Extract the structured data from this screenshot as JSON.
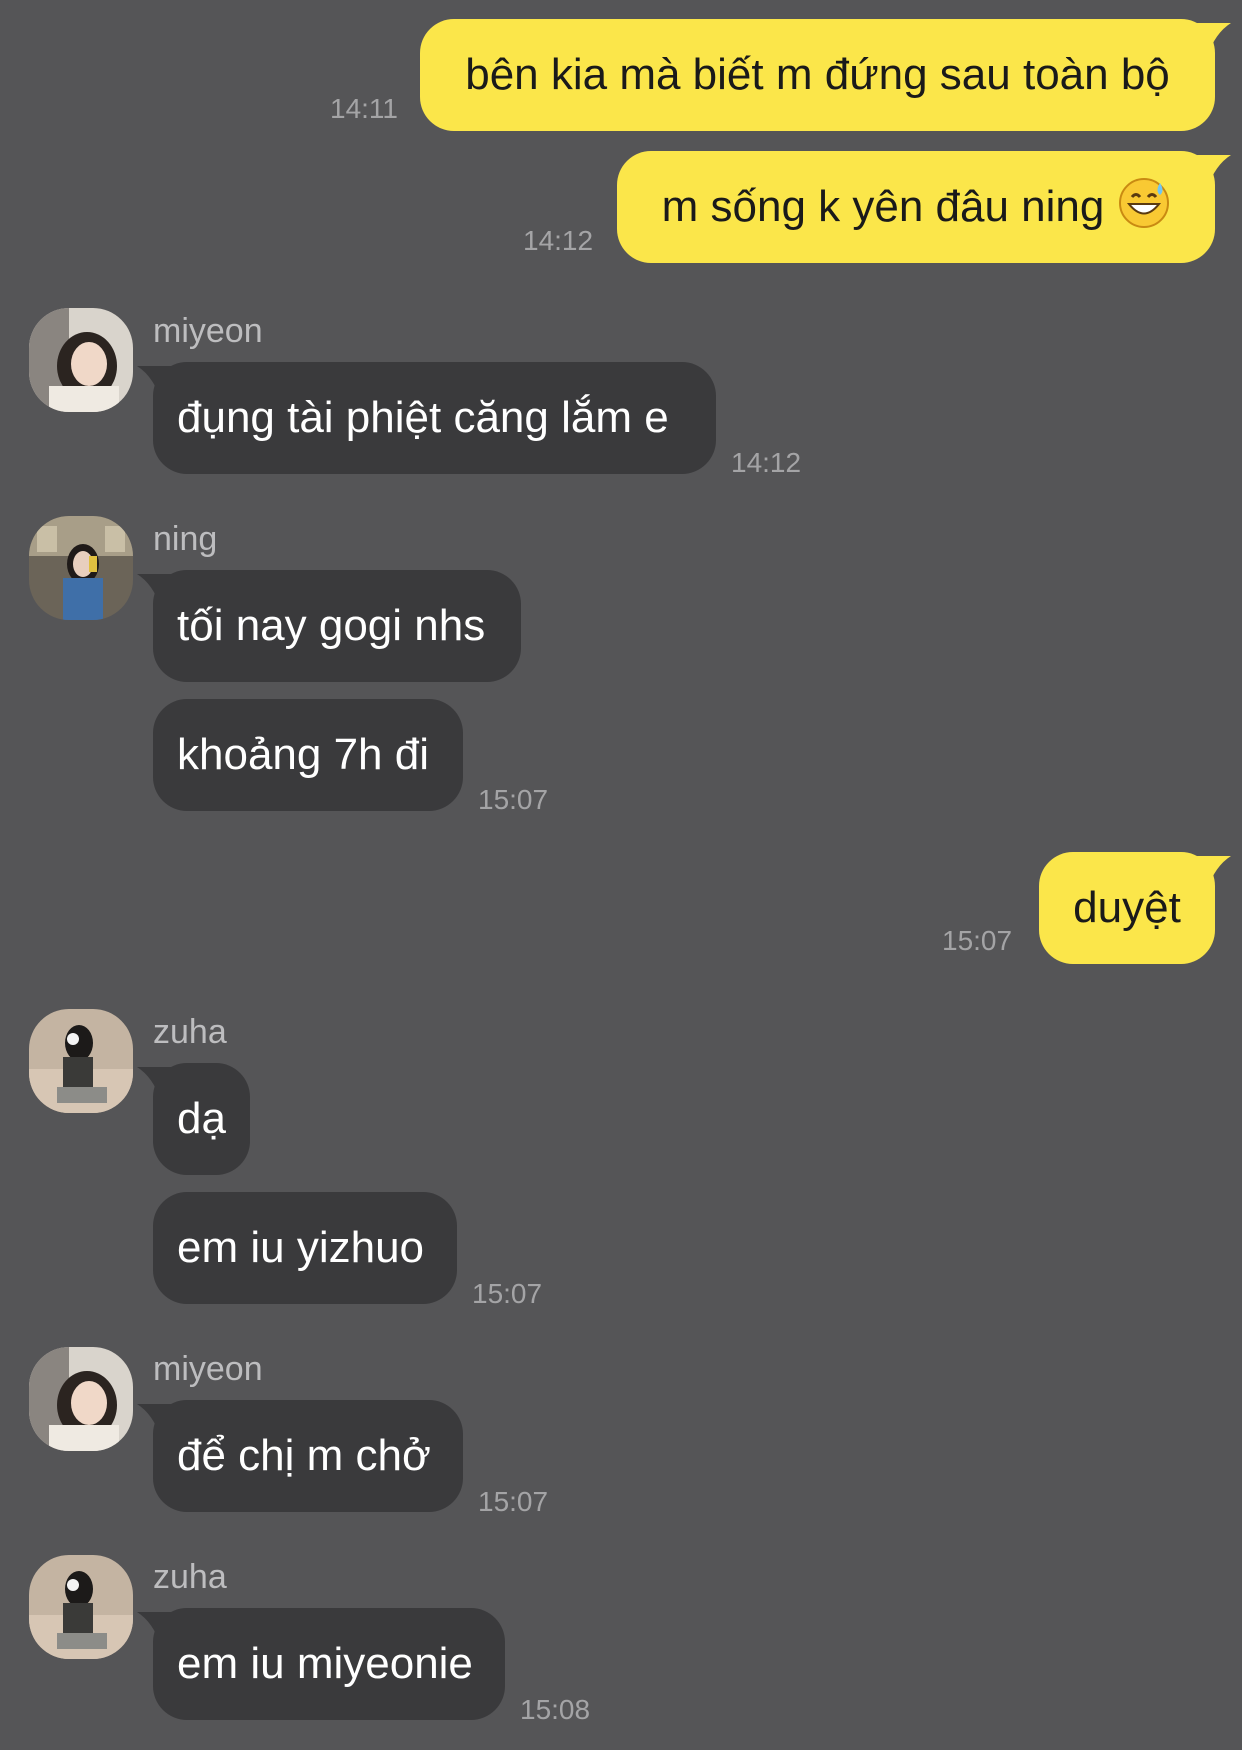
{
  "theme": {
    "background": "#555557",
    "outgoing_bubble": "#FBE64A",
    "incoming_bubble": "#3A3A3C",
    "timestamp_color": "#A4A4A6",
    "sender_color": "#BDBDBF"
  },
  "messages": [
    {
      "side": "out",
      "text": "bên kia mà biết m đứng sau toàn bộ",
      "time": "14:11"
    },
    {
      "side": "out",
      "text": "m sống k yên đâu ning",
      "emoji": "grinning-face-with-sweat",
      "time": "14:12"
    },
    {
      "side": "in",
      "sender": "miyeon",
      "text": "đụng tài phiệt căng lắm e",
      "time": "14:12"
    },
    {
      "side": "in",
      "sender": "ning",
      "text": "tối nay gogi nhs"
    },
    {
      "side": "in",
      "text": "khoảng 7h đi",
      "time": "15:07"
    },
    {
      "side": "out",
      "text": "duyệt",
      "time": "15:07"
    },
    {
      "side": "in",
      "sender": "zuha",
      "text": "dạ"
    },
    {
      "side": "in",
      "text": "em iu yizhuo",
      "time": "15:07"
    },
    {
      "side": "in",
      "sender": "miyeon",
      "text": "để chị m chở",
      "time": "15:07"
    },
    {
      "side": "in",
      "sender": "zuha",
      "text": "em iu miyeonie",
      "time": "15:08"
    }
  ]
}
